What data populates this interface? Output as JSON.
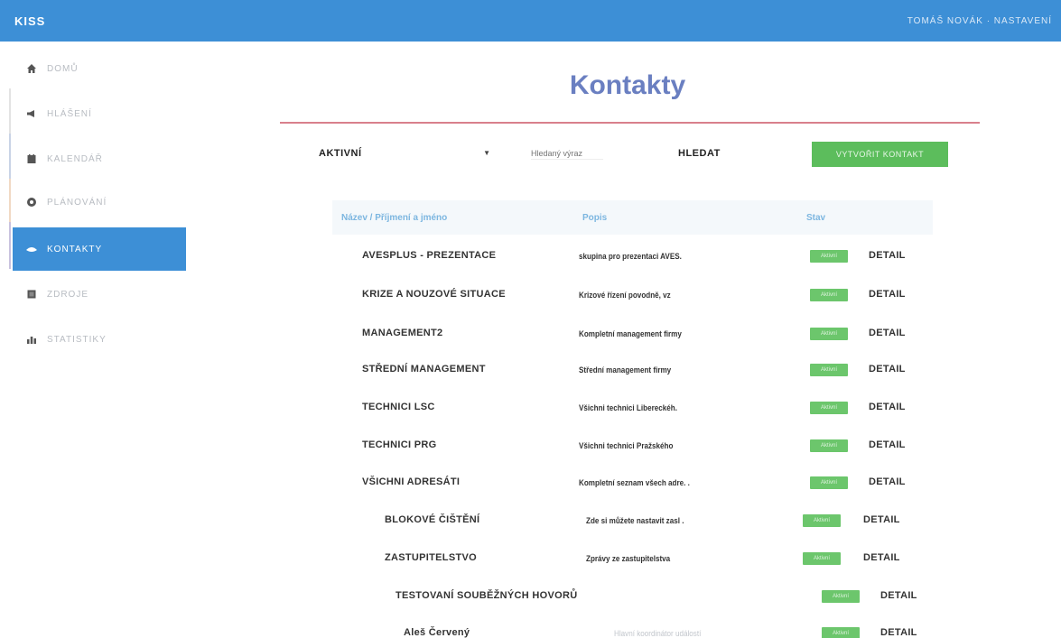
{
  "app": {
    "brand": "KISS",
    "user_menu": "TOMÁŠ NOVÁK · NASTAVENÍ"
  },
  "sidebar": {
    "items": [
      {
        "label": "Domů",
        "icon": "home-icon"
      },
      {
        "label": "Hlášení",
        "icon": "megaphone-icon"
      },
      {
        "label": "Kalendář",
        "icon": "calendar-icon"
      },
      {
        "label": "Plánování",
        "icon": "clock-icon"
      },
      {
        "label": "Kontakty",
        "icon": "contacts-icon",
        "active": true
      },
      {
        "label": "Zdroje",
        "icon": "resources-icon"
      },
      {
        "label": "Statistiky",
        "icon": "stats-icon"
      }
    ]
  },
  "page": {
    "title": "Kontakty"
  },
  "filters": {
    "status_value": "AKTIVNÍ",
    "search_placeholder": "Hledaný výraz",
    "search_label": "HLEDAT",
    "new_button": "VYTVOŘIT KONTAKT"
  },
  "table": {
    "headers": {
      "name": "Název / Příjmení a jméno",
      "desc": "Popis",
      "status": "Stav"
    },
    "status_label": "Aktivní",
    "detail_label": "DETAIL",
    "rows": [
      {
        "name": "AVESPLUS - PREZENTACE",
        "desc": "skupina pro prezentaci AVES."
      },
      {
        "name": "KRIZE A NOUZOVÉ SITUACE",
        "desc": "Krizové řízení povodně, vz"
      },
      {
        "name": "MANAGEMENT2",
        "desc": "Kompletní management firmy"
      },
      {
        "name": "STŘEDNÍ MANAGEMENT",
        "desc": "Střední management firmy"
      },
      {
        "name": "TECHNICI LSC",
        "desc": "Všichni technici Libereckéh."
      },
      {
        "name": "TECHNICI PRG",
        "desc": "Všichni technici Pražského"
      },
      {
        "name": "VŠICHNI ADRESÁTI",
        "desc": "Kompletní seznam všech adre. ."
      },
      {
        "name": "BLOKOVÉ ČIŠTĚNÍ",
        "desc": "Zde si můžete nastavit zasl ."
      },
      {
        "name": "ZASTUPITELSTVO",
        "desc": "Zprávy ze zastupitelstva"
      },
      {
        "name": "TESTOVANÍ SOUBĚŽNÝCH HOVORŮ",
        "desc": ""
      },
      {
        "name": "Aleš Červený",
        "desc": "Hlavní koordinátor událostí"
      }
    ]
  }
}
